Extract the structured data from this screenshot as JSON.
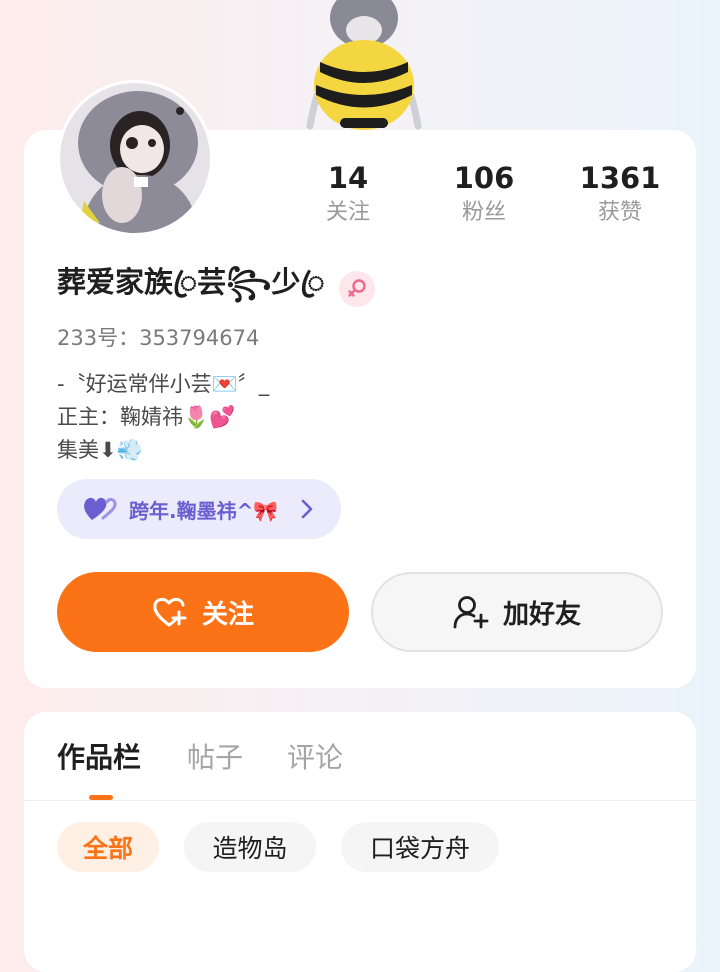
{
  "profile": {
    "username": "葬爱家族ꦿ芸꧂少ꦿ",
    "gender": "female",
    "id_line": "233号：353794674",
    "bio": [
      "-〝好运常伴小芸💌〞_",
      "正主：鞠婧祎🌷💕",
      "集美⬇💨"
    ],
    "tag": "跨年.鞠墨祎^🎀"
  },
  "stats": [
    {
      "value": "14",
      "label": "关注"
    },
    {
      "value": "106",
      "label": "粉丝"
    },
    {
      "value": "1361",
      "label": "获赞"
    }
  ],
  "actions": {
    "follow": "关注",
    "add_friend": "加好友"
  },
  "tabs": [
    "作品栏",
    "帖子",
    "评论"
  ],
  "filters": [
    "全部",
    "造物岛",
    "口袋方舟"
  ],
  "colors": {
    "accent": "#fb7316",
    "tag_bg": "#ecebfb",
    "tag_text": "#6a5fd0",
    "gender_female": "#ec6a8e"
  },
  "icons": {
    "follow": "heart-plus-icon",
    "add_friend": "person-plus-icon",
    "tag": "purple-heart-icon",
    "chevron": "chevron-right-icon",
    "gender": "female-symbol-icon"
  }
}
